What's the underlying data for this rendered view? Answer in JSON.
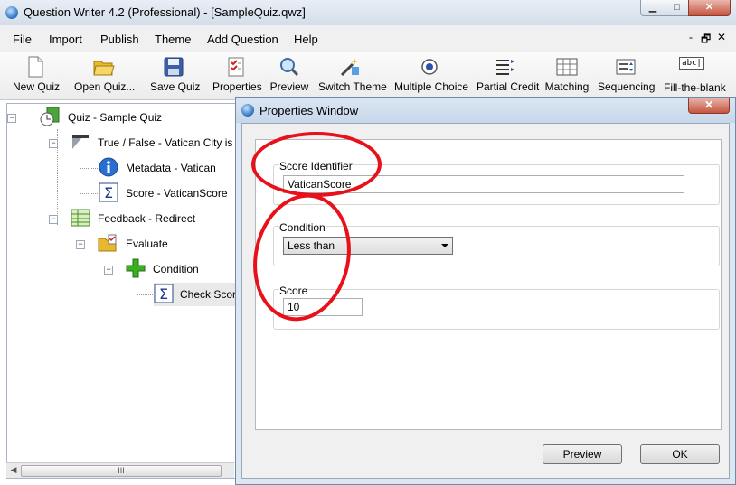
{
  "window": {
    "title": "Question Writer 4.2 (Professional) - [SampleQuiz.qwz]",
    "min_glyph": "▁",
    "max_glyph": "□",
    "close_glyph": "✕"
  },
  "menu": {
    "items": [
      {
        "label": "File"
      },
      {
        "label": "Import"
      },
      {
        "label": "Publish"
      },
      {
        "label": "Theme"
      },
      {
        "label": "Add Question"
      },
      {
        "label": "Help"
      }
    ],
    "mdi_min": "-",
    "mdi_restore": "🗗",
    "mdi_close": "✕"
  },
  "toolbar": {
    "buttons": [
      {
        "label": "New Quiz",
        "icon": "new-document-icon"
      },
      {
        "label": "Open Quiz...",
        "icon": "open-folder-icon"
      },
      {
        "label": "Save Quiz",
        "icon": "floppy-disk-icon"
      },
      {
        "label": "Properties",
        "icon": "properties-checklist-icon"
      },
      {
        "label": "Preview",
        "icon": "magnifier-icon"
      },
      {
        "label": "Switch Theme",
        "icon": "magic-wand-icon"
      },
      {
        "label": "Multiple Choice",
        "icon": "radio-button-icon"
      },
      {
        "label": "Partial Credit",
        "icon": "list-arrows-icon"
      },
      {
        "label": "Matching",
        "icon": "grid-icon"
      },
      {
        "label": "Sequencing",
        "icon": "sequence-icon"
      },
      {
        "label": "Fill-the-blank",
        "icon": "text-field-icon"
      }
    ],
    "fill_blank_icon_text": "abc|"
  },
  "tree": {
    "nodes": [
      {
        "label": "Quiz - Sample Quiz",
        "icon": "quiz-clock-icon"
      },
      {
        "label": "True / False - Vatican City is ent",
        "icon": "true-false-icon"
      },
      {
        "label": "Metadata - Vatican",
        "icon": "info-icon"
      },
      {
        "label": "Score - VaticanScore",
        "icon": "sigma-icon"
      },
      {
        "label": "Feedback - Redirect",
        "icon": "feedback-grid-icon"
      },
      {
        "label": "Evaluate",
        "icon": "evaluate-folder-icon"
      },
      {
        "label": "Condition",
        "icon": "plus-icon"
      },
      {
        "label": "Check Scor",
        "icon": "sigma-icon"
      }
    ],
    "expanders": {
      "quiz": "−",
      "truefalse": "−",
      "feedback": "−",
      "evaluate": "−",
      "condition": "−"
    },
    "hscroll_left": "◀",
    "hscroll_thumb": "III"
  },
  "properties_window": {
    "title": "Properties Window",
    "close_glyph": "✕",
    "score_identifier": {
      "label": "Score Identifier",
      "value": "VaticanScore"
    },
    "condition": {
      "label": "Condition",
      "selected": "Less than"
    },
    "score": {
      "label": "Score",
      "value": "10"
    },
    "preview_button": "Preview",
    "ok_button": "OK"
  },
  "colors": {
    "annotation_red": "#e8101a",
    "accent_blue": "#2c6fbf"
  }
}
